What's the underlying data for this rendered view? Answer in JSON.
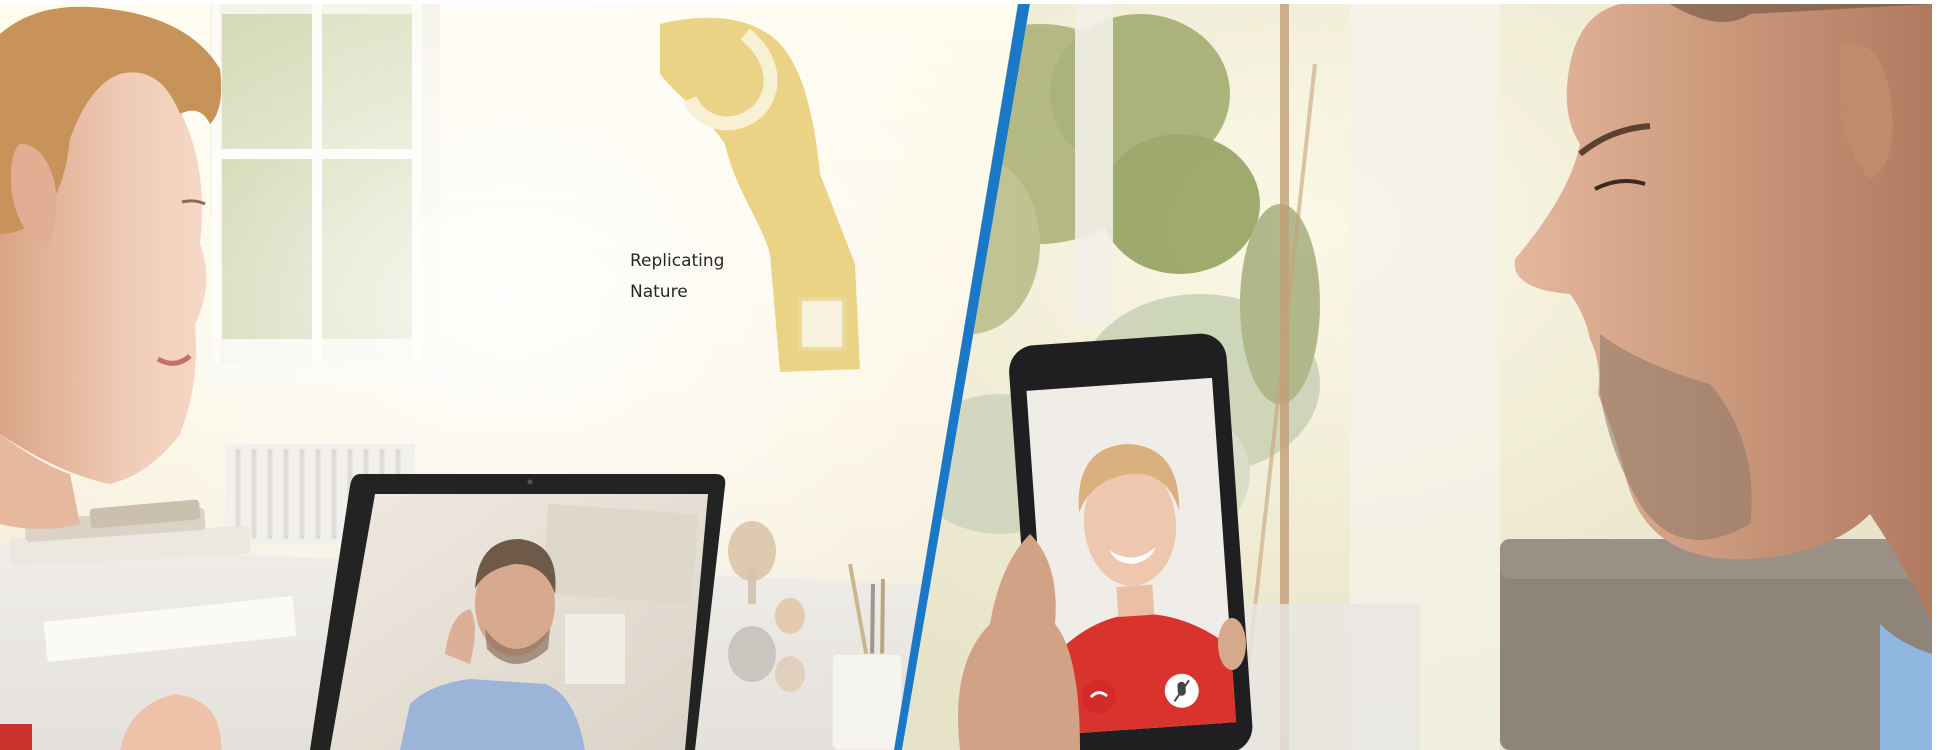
{
  "scene": {
    "left_panel": {
      "subject": "woman-video-calling-on-laptop",
      "wall_sign_text": [
        "Replicating",
        "Nature"
      ]
    },
    "right_panel": {
      "subject": "man-video-calling-on-smartphone"
    }
  },
  "phone": {
    "buttons": [
      {
        "icon": "phone-hangup-icon",
        "color": "#d62a2a"
      },
      {
        "icon": "microphone-mute-icon",
        "color": "#ffffff"
      }
    ]
  },
  "colors": {
    "divider_accent": "#1a78c6",
    "warm_background": "#fbf4e1",
    "garden_green": "#8a9a56"
  }
}
